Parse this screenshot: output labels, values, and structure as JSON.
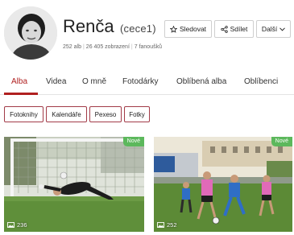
{
  "profile": {
    "name": "Renča",
    "username": "(cece1)",
    "stats": {
      "albums": "252 alb",
      "views": "26 405 zobrazení",
      "fans": "7 fanoušků"
    }
  },
  "actions": {
    "follow_label": "Sledovat",
    "share_label": "Sdílet",
    "more_label": "Další"
  },
  "tabs": [
    {
      "label": "Alba",
      "active": true
    },
    {
      "label": "Videa"
    },
    {
      "label": "O mně"
    },
    {
      "label": "Fotodárky"
    },
    {
      "label": "Oblíbená alba"
    },
    {
      "label": "Oblíbenci"
    }
  ],
  "chips": [
    "Fotoknihy",
    "Kalendáře",
    "Pexeso",
    "Fotky"
  ],
  "albums": [
    {
      "badge": "Nové",
      "photo_count": "236"
    },
    {
      "badge": "Nové",
      "photo_count": "252"
    }
  ],
  "colors": {
    "accent": "#b02020",
    "chip_border": "#a23b48",
    "badge": "#5cb85c"
  }
}
